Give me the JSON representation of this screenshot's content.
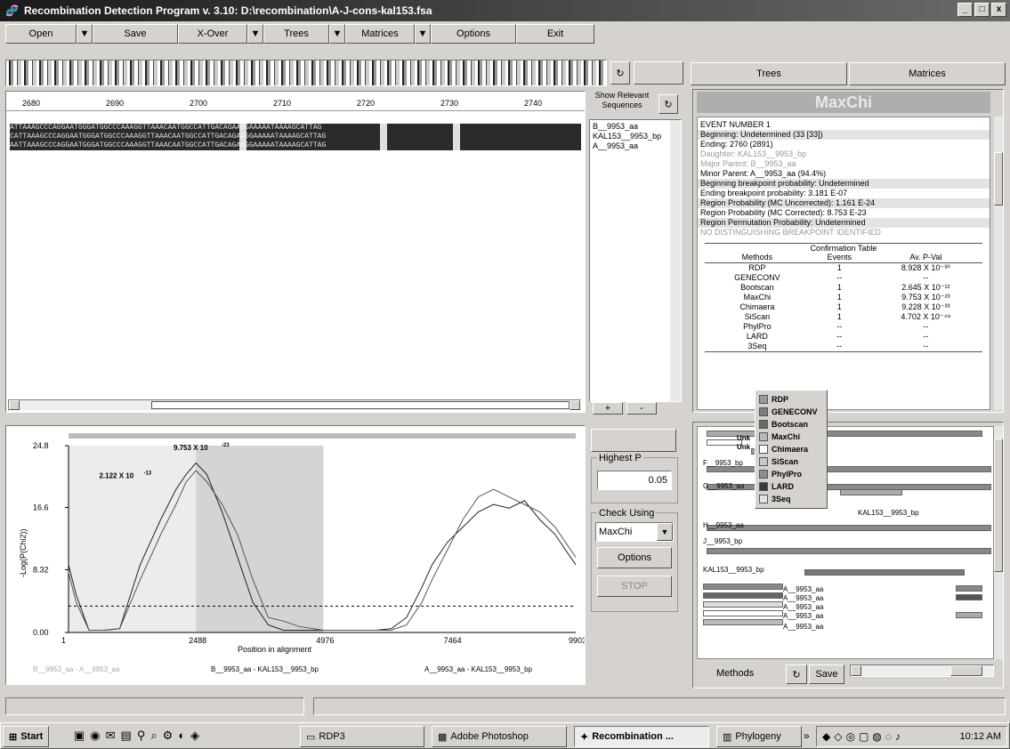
{
  "window": {
    "title": "Recombination Detection Program v. 3.10: D:\\recombination\\A-J-cons-kal153.fsa",
    "min": "_",
    "max": "□",
    "close": "x"
  },
  "menu": [
    {
      "label": "Open",
      "dd": true
    },
    {
      "label": "Save",
      "dd": false
    },
    {
      "label": "X-Over",
      "dd": true
    },
    {
      "label": "Trees",
      "dd": true
    },
    {
      "label": "Matrices",
      "dd": true
    },
    {
      "label": "Options",
      "dd": false
    },
    {
      "label": "Exit",
      "dd": false
    }
  ],
  "dropdown_glyph": "▼",
  "refresh_glyph": "↻",
  "ruler": [
    "2680",
    "2690",
    "2700",
    "2710",
    "2720",
    "2730",
    "2740"
  ],
  "seq_rows": [
    "ATTAAAGCCCAGGAATGGGATGGCCCAAAGGTTAAACAATGGCCATTGACAGAAGGAAAAATAAAAGCATTAG",
    "CATTAAAGCCCAGGAATGGGATGGCCCAAAGGTTAAACAATGGCCATTGACAGAAGGAAAAATAAAAGCATTAG",
    "AATTAAAGCCCAGGAATGGGATGGCCCAAAGGTTAAACAATGGCCATTGACAGAAGGAAAAATAAAAGCATTAG"
  ],
  "show_relevant": "Show Relevant Sequences",
  "seq_names": [
    "B__9953_aa",
    "KAL153__9953_bp",
    "A__9953_aa"
  ],
  "plus": "+",
  "minus": "-",
  "right_tabs": [
    "Trees",
    "Matrices"
  ],
  "maxchi": "MaxChi",
  "event_lines": [
    {
      "t": "EVENT NUMBER 1",
      "c": ""
    },
    {
      "t": "Beginning: Undetermined (33 [33])",
      "c": "g"
    },
    {
      "t": "Ending: 2760 (2891)",
      "c": ""
    },
    {
      "t": "Daughter: KAL153__9953_bp",
      "c": "lg"
    },
    {
      "t": "Major Parent: B__9953_aa",
      "c": "lg"
    },
    {
      "t": "Minor Parent: A__9953_aa (94.4%)",
      "c": ""
    },
    {
      "t": "Beginning breakpoint probability: Undetermined",
      "c": "g"
    },
    {
      "t": "Ending breakpoint probability: 3.181 E-07",
      "c": ""
    },
    {
      "t": "Region Probability (MC Uncorrected): 1.161 E-24",
      "c": "g"
    },
    {
      "t": "Region Probability (MC Corrected): 8.753 E-23",
      "c": ""
    },
    {
      "t": "Region Permutation Probability: Undetermined",
      "c": "g"
    },
    {
      "t": "NO DISTINGUISHING BREAKPOINT IDENTIFIED",
      "c": "lg"
    }
  ],
  "conf": {
    "title": "Confirmation Table",
    "headers": [
      "Methods",
      "Events",
      "Av. P-Val"
    ],
    "rows": [
      [
        "RDP",
        "1",
        "8.928 X 10⁻³⁰"
      ],
      [
        "GENECONV",
        "--",
        "--"
      ],
      [
        "Bootscan",
        "1",
        "2.645 X 10⁻¹²"
      ],
      [
        "MaxChi",
        "1",
        "9.753 X 10⁻²³"
      ],
      [
        "Chimaera",
        "1",
        "9.228 X 10⁻³³"
      ],
      [
        "SiScan",
        "1",
        "4.702 X 10⁻⁴⁸"
      ],
      [
        "PhylPro",
        "--",
        "--"
      ],
      [
        "LARD",
        "--",
        "--"
      ],
      [
        "3Seq",
        "--",
        "--"
      ]
    ]
  },
  "legend": [
    {
      "name": "RDP",
      "color": "#9a9a9a"
    },
    {
      "name": "GENECONV",
      "color": "#7d7d7d"
    },
    {
      "name": "Bootscan",
      "color": "#6a6a6a"
    },
    {
      "name": "MaxChi",
      "color": "#b9b9b9"
    },
    {
      "name": "Chimaera",
      "color": "#ffffff"
    },
    {
      "name": "SiScan",
      "color": "#c8c8c8"
    },
    {
      "name": "PhylPro",
      "color": "#8e8e8e"
    },
    {
      "name": "LARD",
      "color": "#3a3a3a"
    },
    {
      "name": "3Seq",
      "color": "#e2e2e2"
    }
  ],
  "chart_data": {
    "type": "line",
    "ylabel": "-Log(P(Chi2))",
    "xlabel": "Position in alignment",
    "xlim": [
      1,
      9903
    ],
    "ylim": [
      0,
      24.8
    ],
    "xticks": [
      "1",
      "2488",
      "4976",
      "7464",
      "9903"
    ],
    "yticks": [
      "24.8",
      "16.6",
      "8.32",
      "0.00"
    ],
    "annot1": "9.753 X 10",
    "annot1_exp": "-23",
    "annot2": "2.122 X 10",
    "annot2_exp": "-13",
    "threshold": 3.5,
    "legend_bottom": [
      "B__9953_aa - A__9953_aa",
      "B__9953_aa - KAL153__9953_bp",
      "A__9953_aa - KAL153__9953_bp"
    ],
    "series": [
      {
        "x": [
          1,
          150,
          400,
          700,
          1000,
          1400,
          1800,
          2100,
          2300,
          2488,
          2700,
          3000,
          3300,
          3600,
          3900,
          4200,
          4500,
          4976,
          5500,
          6000,
          6300,
          6600,
          6900,
          7100,
          7400,
          7700,
          8000,
          8300,
          8600,
          8900,
          9200,
          9500,
          9700,
          9903
        ],
        "y": [
          9,
          5,
          0.3,
          0.3,
          0.5,
          9,
          15,
          19,
          21,
          22.5,
          21,
          16,
          10,
          4,
          1,
          0.3,
          0.3,
          0.3,
          0.3,
          0.3,
          0.5,
          2,
          6,
          9,
          12,
          14,
          16,
          17,
          16.5,
          17.5,
          15,
          13,
          11,
          9
        ]
      },
      {
        "x": [
          1,
          150,
          400,
          700,
          1000,
          1400,
          1800,
          2100,
          2300,
          2488,
          2700,
          3000,
          3300,
          3600,
          3900,
          4200,
          4500,
          4976,
          5500,
          6000,
          6300,
          6600,
          6900,
          7100,
          7400,
          7700,
          8000,
          8300,
          8600,
          8900,
          9200,
          9500,
          9700,
          9903
        ],
        "y": [
          8,
          4,
          0.3,
          0.3,
          0.5,
          7,
          13,
          17,
          20,
          21.5,
          20,
          17,
          13,
          7,
          2,
          1.5,
          0.8,
          0.3,
          0.3,
          0.3,
          0.3,
          1,
          4,
          7,
          11,
          15,
          18,
          19,
          18,
          17,
          16,
          14,
          12,
          10
        ]
      }
    ]
  },
  "highest_p": {
    "label": "Highest P",
    "value": "0.05"
  },
  "check_using": {
    "label": "Check Using",
    "value": "MaxChi"
  },
  "options_btn": "Options",
  "stop_btn": "STOP",
  "tree_overlay": [
    "Unk",
    "Unk"
  ],
  "tree_labels": [
    "F__9953_bp",
    "G__9953_aa",
    "KAL153__9953_bp",
    "H__9953_aa",
    "J__9953_bp",
    "KAL153__9953_bp",
    "A__9953_aa",
    "A__9953_aa",
    "A__9953_aa",
    "A__9953_aa",
    "A__9953_aa"
  ],
  "bottom_right": {
    "methods": "Methods",
    "save": "Save"
  },
  "taskbar": {
    "start": "Start",
    "tasks": [
      "RDP3",
      "Adobe Photoshop",
      "Recombination ...",
      "Phylogeny"
    ],
    "chevron": "»",
    "time": "10:12 AM"
  }
}
